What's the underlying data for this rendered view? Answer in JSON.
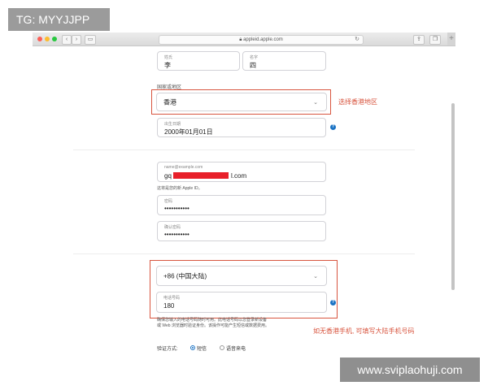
{
  "browser": {
    "url": "appleid.apple.com",
    "back": "‹",
    "forward": "›",
    "reload": "↻",
    "newtab": "+"
  },
  "form": {
    "last_name": {
      "label": "姓氏",
      "value": "李"
    },
    "first_name": {
      "label": "名字",
      "value": "四"
    },
    "region": {
      "label": "国家或地区",
      "value": "香港"
    },
    "birthday": {
      "label": "出生日期",
      "value": "2000年01月01日"
    },
    "email": {
      "placeholder": "name@example.com",
      "value_prefix": "gq",
      "value_suffix": "l.com"
    },
    "email_note": "这将是您的新 Apple ID。",
    "password": {
      "label": "密码",
      "value": "•••••••••••"
    },
    "confirm_password": {
      "label": "确认密码",
      "value": "•••••••••••"
    },
    "phone_code": {
      "value": "+86 (中国大陆)"
    },
    "phone": {
      "label": "电话号码",
      "value": "180"
    },
    "phone_note_line1": "确保您输入的电话号码随时可用。此电话号码以您登录新设备",
    "phone_note_line2": "或 Web 浏览器时验证身份。该操作可能产生短信或数据费用。",
    "verify": {
      "label": "验证方式:",
      "option_sms": "短信",
      "option_call": "语音来电"
    }
  },
  "annotations": {
    "region_hint": "选择香港地区",
    "phone_hint": "如无香港手机, 可填写大陆手机号码"
  },
  "overlay": {
    "tag": "TG: MYYJJPP",
    "watermark": "www.sviplaohuji.com"
  },
  "colors": {
    "annotation": "#d8553f",
    "accent": "#1b73c4"
  }
}
